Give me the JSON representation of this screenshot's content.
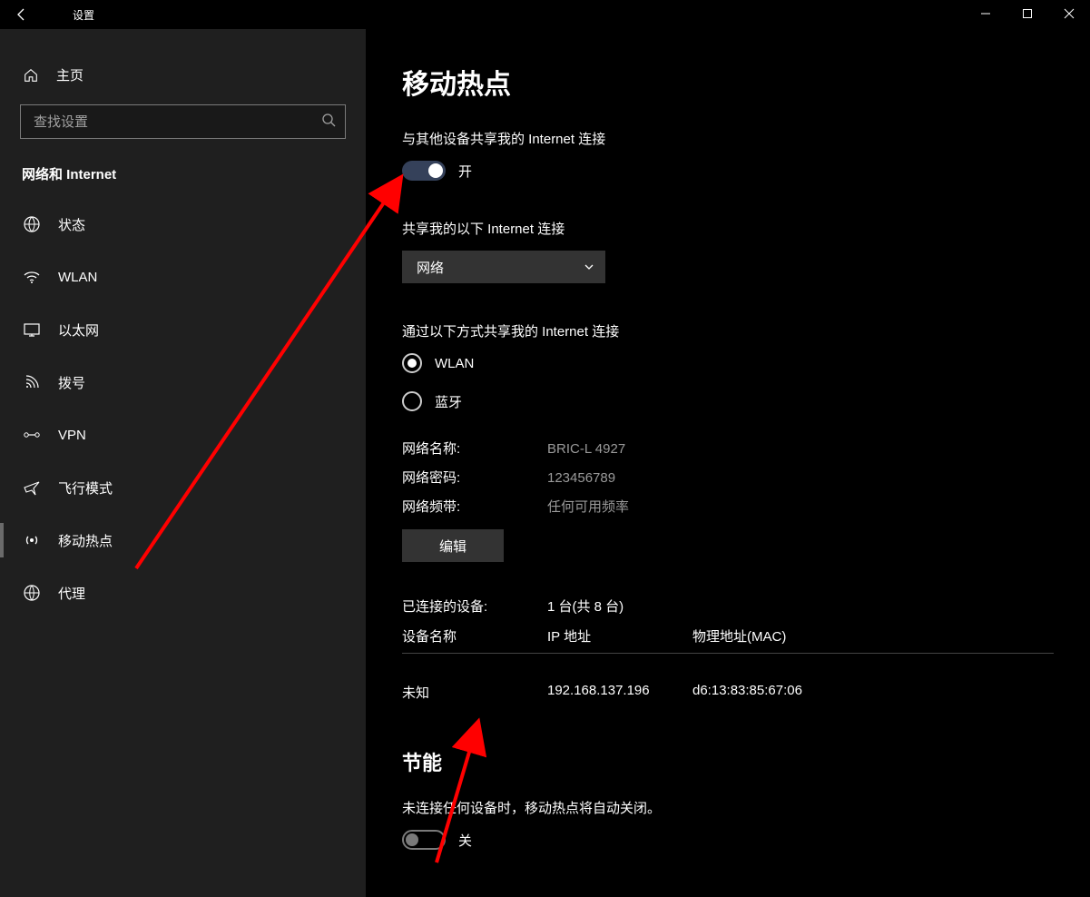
{
  "window": {
    "title": "设置"
  },
  "sidebar": {
    "home": "主页",
    "search_placeholder": "查找设置",
    "section": "网络和 Internet",
    "items": [
      {
        "label": "状态",
        "icon": "status"
      },
      {
        "label": "WLAN",
        "icon": "wifi"
      },
      {
        "label": "以太网",
        "icon": "ethernet"
      },
      {
        "label": "拨号",
        "icon": "dialup"
      },
      {
        "label": "VPN",
        "icon": "vpn"
      },
      {
        "label": "飞行模式",
        "icon": "airplane"
      },
      {
        "label": "移动热点",
        "icon": "hotspot",
        "selected": true
      },
      {
        "label": "代理",
        "icon": "proxy"
      }
    ]
  },
  "main": {
    "page_title": "移动热点",
    "share_label": "与其他设备共享我的 Internet 连接",
    "share_toggle_state": "开",
    "share_toggle_on": true,
    "share_conn_label": "共享我的以下 Internet 连接",
    "share_conn_value": "网络",
    "share_via_label": "通过以下方式共享我的 Internet 连接",
    "radios": [
      {
        "label": "WLAN",
        "checked": true
      },
      {
        "label": "蓝牙",
        "checked": false
      }
    ],
    "net_name_key": "网络名称:",
    "net_name_val": "BRIC-L 4927",
    "net_pass_key": "网络密码:",
    "net_pass_val": "123456789",
    "net_band_key": "网络频带:",
    "net_band_val": "任何可用频率",
    "edit_btn": "编辑",
    "connected_key": "已连接的设备:",
    "connected_val": "1 台(共 8 台)",
    "dev_col1": "设备名称",
    "dev_col2": "IP 地址",
    "dev_col3": "物理地址(MAC)",
    "dev_row": {
      "name": "未知",
      "ip": "192.168.137.196",
      "mac": "d6:13:83:85:67:06"
    },
    "power_heading": "节能",
    "power_desc": "未连接任何设备时，移动热点将自动关闭。",
    "power_toggle_state": "关",
    "power_toggle_on": false
  }
}
